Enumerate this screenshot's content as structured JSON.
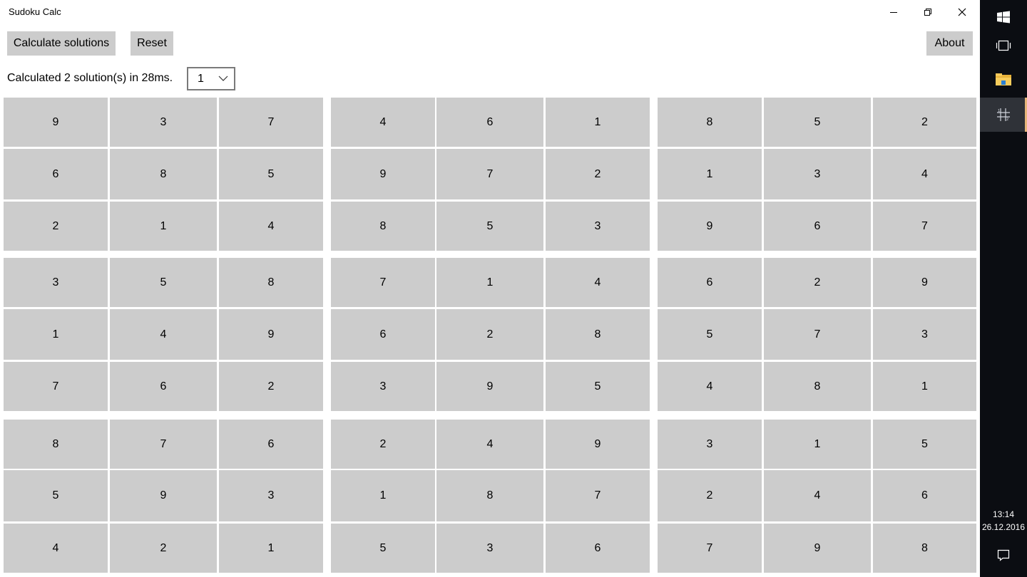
{
  "window": {
    "title": "Sudoku Calc"
  },
  "toolbar": {
    "calculate_label": "Calculate solutions",
    "reset_label": "Reset",
    "about_label": "About"
  },
  "status": {
    "message": "Calculated 2 solution(s) in 28ms.",
    "selected_solution": "1"
  },
  "grid": {
    "rows": [
      [
        9,
        3,
        7,
        4,
        6,
        1,
        8,
        5,
        2
      ],
      [
        6,
        8,
        5,
        9,
        7,
        2,
        1,
        3,
        4
      ],
      [
        2,
        1,
        4,
        8,
        5,
        3,
        9,
        6,
        7
      ],
      [
        3,
        5,
        8,
        7,
        1,
        4,
        6,
        2,
        9
      ],
      [
        1,
        4,
        9,
        6,
        2,
        8,
        5,
        7,
        3
      ],
      [
        7,
        6,
        2,
        3,
        9,
        5,
        4,
        8,
        1
      ],
      [
        8,
        7,
        6,
        2,
        4,
        9,
        3,
        1,
        5
      ],
      [
        5,
        9,
        3,
        1,
        8,
        7,
        2,
        4,
        6
      ],
      [
        4,
        2,
        1,
        5,
        3,
        6,
        7,
        9,
        8
      ]
    ]
  },
  "taskbar": {
    "time": "13:14",
    "date": "26.12.2016",
    "icons": [
      "windows-start-icon",
      "task-view-icon",
      "file-explorer-icon",
      "sudoku-app-icon",
      "action-center-icon"
    ]
  },
  "colors": {
    "cell_background": "#cccccc",
    "taskbar_background": "#0b0d12",
    "active_app_indicator": "#e7b57a"
  }
}
